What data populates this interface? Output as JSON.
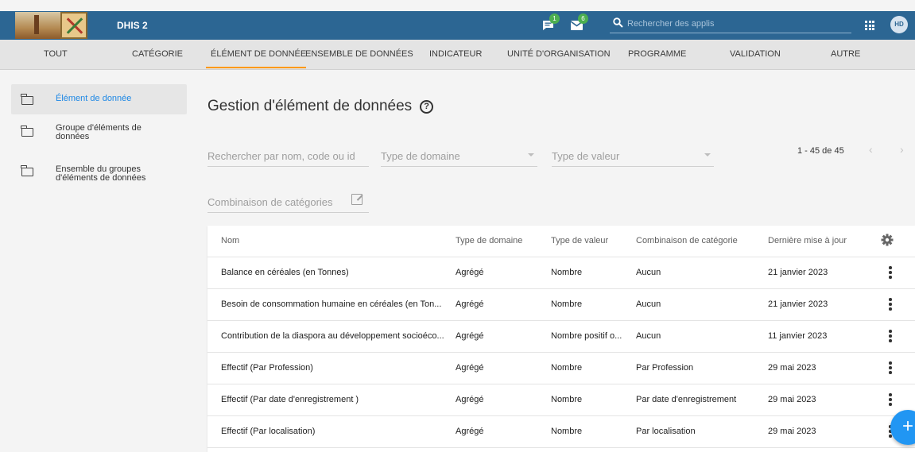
{
  "header": {
    "app_title": "DHIS 2",
    "messages_badge": "1",
    "interpretations_badge": "6",
    "search_placeholder": "Rechercher des applis",
    "user_initials": "HD",
    "colors": {
      "bar": "#2c6693",
      "badge": "#4caf50"
    }
  },
  "tabs": [
    "TOUT",
    "CATÉGORIE",
    "ÉLÉMENT DE DONNÉE",
    "ENSEMBLE DE DONNÉES",
    "INDICATEUR",
    "UNITÉ D'ORGANISATION",
    "PROGRAMME",
    "VALIDATION",
    "AUTRE"
  ],
  "active_tab": "ÉLÉMENT DE DONNÉE",
  "sidebar": {
    "items": [
      {
        "label": "Élément de donnée",
        "active": true
      },
      {
        "label": "Groupe d'éléments de données",
        "active": false
      },
      {
        "label": "Ensemble du groupes d'éléments de données",
        "active": false
      }
    ]
  },
  "main": {
    "title": "Gestion d'élément de données",
    "filters": {
      "search_placeholder": "Rechercher par nom, code ou id",
      "domain_type": "Type de domaine",
      "value_type": "Type de valeur",
      "category_combo": "Combinaison de catégories"
    },
    "pager": "1 - 45 de 45"
  },
  "table": {
    "columns": [
      "Nom",
      "Type de domaine",
      "Type de valeur",
      "Combinaison de catégorie",
      "Dernière mise à jour"
    ],
    "rows": [
      [
        "Balance en céréales (en Tonnes)",
        "Agrégé",
        "Nombre",
        "Aucun",
        "21 janvier 2023"
      ],
      [
        "Besoin de consommation humaine en céréales (en Ton...",
        "Agrégé",
        "Nombre",
        "Aucun",
        "21 janvier 2023"
      ],
      [
        "Contribution de la diaspora au développement socioéco...",
        "Agrégé",
        "Nombre positif o...",
        "Aucun",
        "11 janvier 2023"
      ],
      [
        "Effectif (Par Profession)",
        "Agrégé",
        "Nombre",
        "Par Profession",
        "29 mai 2023"
      ],
      [
        "Effectif (Par date d'enregistrement )",
        "Agrégé",
        "Nombre",
        "Par date d'enregistrement",
        "29 mai 2023"
      ],
      [
        "Effectif (Par localisation)",
        "Agrégé",
        "Nombre",
        "Par localisation",
        "29 mai 2023"
      ]
    ]
  },
  "fab_label": "+"
}
